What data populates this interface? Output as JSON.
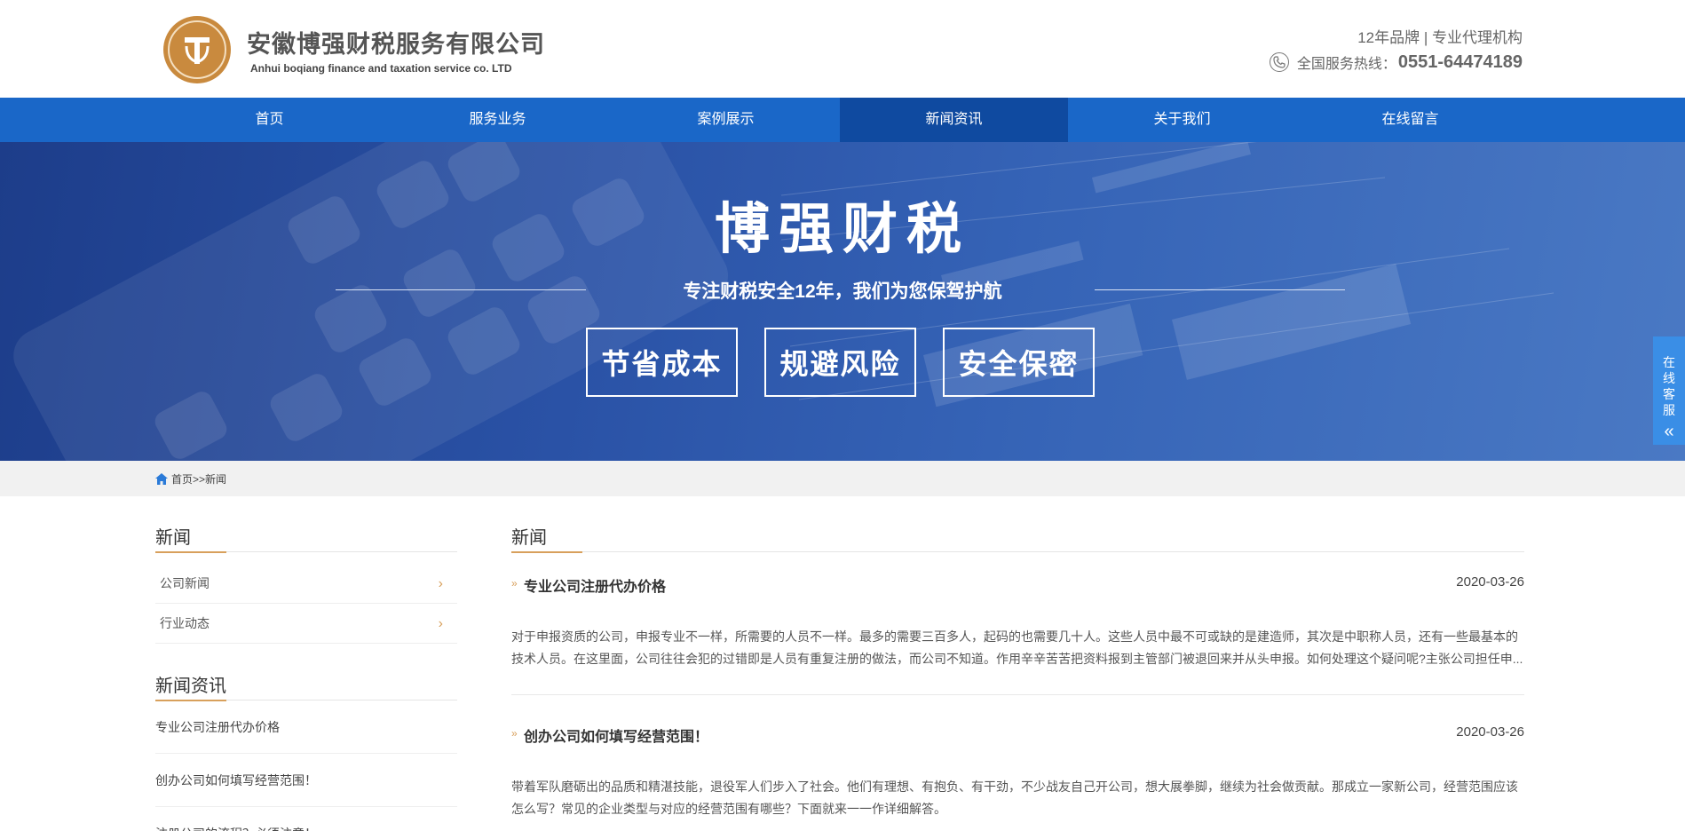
{
  "header": {
    "company_cn": "安徽博强财税服务有限公司",
    "company_en": "Anhui boqiang finance and taxation service co. LTD",
    "slogan": "12年品牌 | 专业代理机构",
    "hotline_label": "全国服务热线：",
    "hotline_number": "0551-64474189"
  },
  "nav": {
    "items": [
      {
        "label": "首页"
      },
      {
        "label": "服务业务"
      },
      {
        "label": "案例展示"
      },
      {
        "label": "新闻资讯"
      },
      {
        "label": "关于我们"
      },
      {
        "label": "在线留言"
      }
    ],
    "active_index": 3
  },
  "banner": {
    "title": "博强财税",
    "subtitle": "专注财税安全12年，我们为您保驾护航",
    "features": [
      "节省成本",
      "规避风险",
      "安全保密"
    ]
  },
  "float_service": {
    "label": "在线客服",
    "icon": "double-chevron-left-icon"
  },
  "breadcrumb": {
    "text": "首页>>新闻"
  },
  "sidebar": {
    "category_title": "新闻",
    "categories": [
      "公司新闻",
      "行业动态"
    ],
    "news_title": "新闻资讯",
    "news_items": [
      "专业公司注册代办价格",
      "创办公司如何填写经营范围！",
      "注册公司的流程？必须注意！"
    ]
  },
  "main": {
    "title": "新闻",
    "articles": [
      {
        "title": "专业公司注册代办价格",
        "date": "2020-03-26",
        "summary": "对于申报资质的公司，申报专业不一样，所需要的人员不一样。最多的需要三百多人，起码的也需要几十人。这些人员中最不可或缺的是建造师，其次是中职称人员，还有一些最基本的技术人员。在这里面，公司往往会犯的过错即是人员有重复注册的做法，而公司不知道。作用辛辛苦苦把资料报到主管部门被退回来并从头申报。如何处理这个疑问呢?主张公司担任申..."
      },
      {
        "title": "创办公司如何填写经营范围！",
        "date": "2020-03-26",
        "summary": "带着军队磨砺出的品质和精湛技能，退役军人们步入了社会。他们有理想、有抱负、有干劲，不少战友自己开公司，想大展拳脚，继续为社会做贡献。那成立一家新公司，经营范围应该怎么写？常见的企业类型与对应的经营范围有哪些？下面就来一一作详细解答。"
      }
    ]
  },
  "colors": {
    "nav_blue": "#1a67c8",
    "nav_active": "#0f4aa0",
    "accent_gold": "#d8a05c",
    "float_blue": "#3a8ee6"
  }
}
